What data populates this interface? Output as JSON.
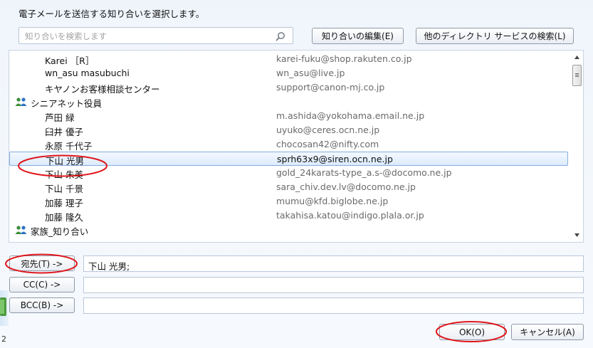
{
  "dialog": {
    "title": "電子メールを送信する知り合いを選択します。"
  },
  "search": {
    "placeholder": "知り合いを検索します",
    "value": ""
  },
  "toolbar": {
    "edit_contacts_label": "知り合いの編集(E)",
    "search_directory_label": "他のディレクトリ サービスの検索(L)"
  },
  "contacts": [
    {
      "name": "Karei ［R］",
      "email": "karei-fuku@shop.rakuten.co.jp"
    },
    {
      "name": "wn_asu masubuchi",
      "email": "wn_asu@live.jp"
    },
    {
      "name": "キヤノンお客様相談センター",
      "email": "support@canon-mj.co.jp"
    },
    {
      "name": "シニアネット役員",
      "email": "",
      "group": true
    },
    {
      "name": "芦田 緑",
      "email": "m.ashida@yokohama.email.ne.jp"
    },
    {
      "name": "臼井 優子",
      "email": "uyuko@ceres.ocn.ne.jp"
    },
    {
      "name": "永原 千代子",
      "email": "chocosan42@nifty.com"
    },
    {
      "name": "下山 光男",
      "email": "sprh63x9@siren.ocn.ne.jp",
      "selected": true
    },
    {
      "name": "下山 朱美",
      "email": "gold_24karats-type_a.s-@docomo.ne.jp"
    },
    {
      "name": "下山 千景",
      "email": "sara_chiv.dev.lv@docomo.ne.jp"
    },
    {
      "name": "加藤 理子",
      "email": "mumu@kfd.biglobe.ne.jp"
    },
    {
      "name": "加藤 隆久",
      "email": "takahisa.katou@indigo.plala.or.jp"
    },
    {
      "name": "家族_知り合い",
      "email": "",
      "group": true
    }
  ],
  "recipients": {
    "to_label": "宛先(T) ->",
    "to_value": "下山 光男;",
    "cc_label": "CC(C) ->",
    "cc_value": "",
    "bcc_label": "BCC(B) ->",
    "bcc_value": ""
  },
  "footer": {
    "ok_label": "OK(O)",
    "cancel_label": "キャンセル(A)"
  },
  "partial_glyph": "2",
  "colors": {
    "selection": "#dcebfd",
    "selection_border": "#84acdd",
    "highlight_ellipse": "#e0161b",
    "email_text": "#6a6a6a"
  }
}
